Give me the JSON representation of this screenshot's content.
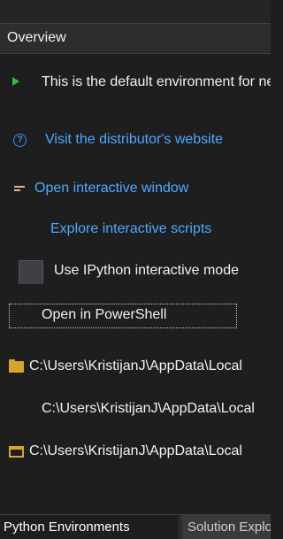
{
  "header": {
    "title": "Overview"
  },
  "items": {
    "default_env": "This is the default environment for new projects",
    "distributor_link": "Visit the distributor's website",
    "open_interactive": "Open interactive window",
    "explore_scripts": "Explore interactive scripts",
    "ipython_mode": "Use IPython interactive mode",
    "open_powershell": "Open in PowerShell",
    "path1": "C:\\Users\\KristijanJ\\AppData\\Local",
    "path2": "C:\\Users\\KristijanJ\\AppData\\Local",
    "path3": "C:\\Users\\KristijanJ\\AppData\\Local"
  },
  "tabs": {
    "python_environments": "Python Environments",
    "solution_explorer": "Solution Explorer"
  },
  "icons": {
    "play": "play-icon",
    "help": "question-circle-icon",
    "window": "interactive-window-icon",
    "folder": "folder-icon",
    "file": "file-icon"
  },
  "colors": {
    "background": "#1e1e1e",
    "link": "#4ea9ff",
    "accent_green": "#3fb43f",
    "folder": "#d7a42d"
  }
}
